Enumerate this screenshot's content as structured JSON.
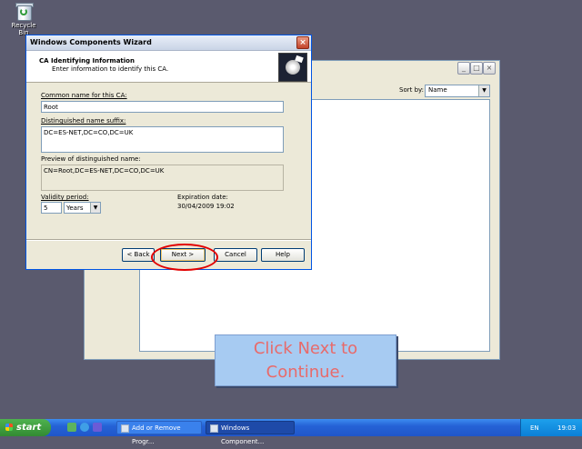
{
  "desktop": {
    "recycle_label": "Recycle Bin"
  },
  "bg_window": {
    "sort_label": "Sort by:",
    "sort_value": "Name"
  },
  "wizard": {
    "title": "Windows Components Wizard",
    "header_title": "CA Identifying Information",
    "header_sub": "Enter information to identify this CA.",
    "common_name_label": "Common name for this CA:",
    "common_name_value": "Root",
    "dn_suffix_label": "Distinguished name suffix:",
    "dn_suffix_value": "DC=ES-NET,DC=CO,DC=UK",
    "preview_label": "Preview of distinguished name:",
    "preview_value": "CN=Root,DC=ES-NET,DC=CO,DC=UK",
    "validity_label": "Validity period:",
    "validity_value": "5",
    "validity_unit": "Years",
    "expiration_label": "Expiration date:",
    "expiration_value": "30/04/2009 19:02",
    "buttons": {
      "back": "< Back",
      "next": "Next >",
      "cancel": "Cancel",
      "help": "Help"
    }
  },
  "callout": {
    "line1": "Click Next to",
    "line2": "Continue."
  },
  "taskbar": {
    "start": "start",
    "tasks": [
      "Add or Remove Progr...",
      "Windows Component..."
    ],
    "language": "EN",
    "clock": "19:03"
  },
  "colors": {
    "highlight": "#e20000",
    "callout_bg": "#a7cbf2",
    "callout_text": "#e86a6a"
  }
}
